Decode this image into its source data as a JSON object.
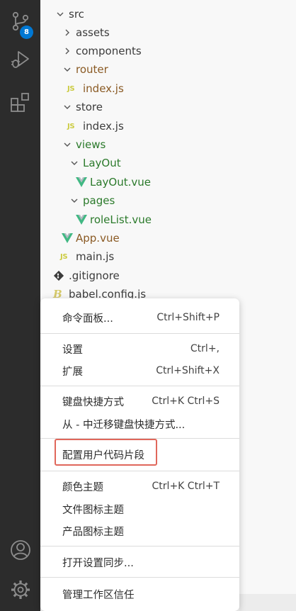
{
  "activity_bar": {
    "items": [
      {
        "icon": "source-control-icon",
        "badge": "8"
      },
      {
        "icon": "run-debug-icon"
      },
      {
        "icon": "extensions-icon"
      }
    ],
    "bottom": [
      {
        "icon": "account-icon"
      },
      {
        "icon": "manage-gear-icon"
      }
    ]
  },
  "explorer": {
    "tree": [
      {
        "label": "src",
        "kind": "folder-open"
      },
      {
        "label": "assets",
        "kind": "folder-closed"
      },
      {
        "label": "components",
        "kind": "folder-closed"
      },
      {
        "label": "router",
        "kind": "folder-open"
      },
      {
        "label": "index.js",
        "kind": "js"
      },
      {
        "label": "store",
        "kind": "folder-open"
      },
      {
        "label": "index.js",
        "kind": "js"
      },
      {
        "label": "views",
        "kind": "folder-open"
      },
      {
        "label": "LayOut",
        "kind": "folder-open"
      },
      {
        "label": "LayOut.vue",
        "kind": "vue"
      },
      {
        "label": "pages",
        "kind": "folder-open"
      },
      {
        "label": "roleList.vue",
        "kind": "vue"
      },
      {
        "label": "App.vue",
        "kind": "vue"
      },
      {
        "label": "main.js",
        "kind": "js"
      },
      {
        "label": ".gitignore",
        "kind": "git"
      },
      {
        "label": "babel.config.js",
        "kind": "babel"
      }
    ],
    "js_badge": "JS"
  },
  "context_menu": {
    "items": [
      {
        "label": "命令面板...",
        "shortcut": "Ctrl+Shift+P"
      },
      {
        "label": "设置",
        "shortcut": "Ctrl+,"
      },
      {
        "label": "扩展",
        "shortcut": "Ctrl+Shift+X"
      },
      {
        "label": "键盘快捷方式",
        "shortcut": "Ctrl+K Ctrl+S"
      },
      {
        "label": "从 - 中迁移键盘快捷方式...",
        "shortcut": ""
      },
      {
        "label": "配置用户代码片段",
        "shortcut": "",
        "highlighted": true
      },
      {
        "label": "颜色主题",
        "shortcut": "Ctrl+K Ctrl+T"
      },
      {
        "label": "文件图标主题",
        "shortcut": ""
      },
      {
        "label": "产品图标主题",
        "shortcut": ""
      },
      {
        "label": "打开设置同步...",
        "shortcut": ""
      },
      {
        "label": "管理工作区信任",
        "shortcut": ""
      }
    ]
  },
  "colors": {
    "activity_bar_bg": "#2c2c2c",
    "badge_bg": "#0078d4",
    "highlight_border": "#e0675b",
    "vue_green": "#41b883",
    "js_yellow": "#cbcb41"
  }
}
